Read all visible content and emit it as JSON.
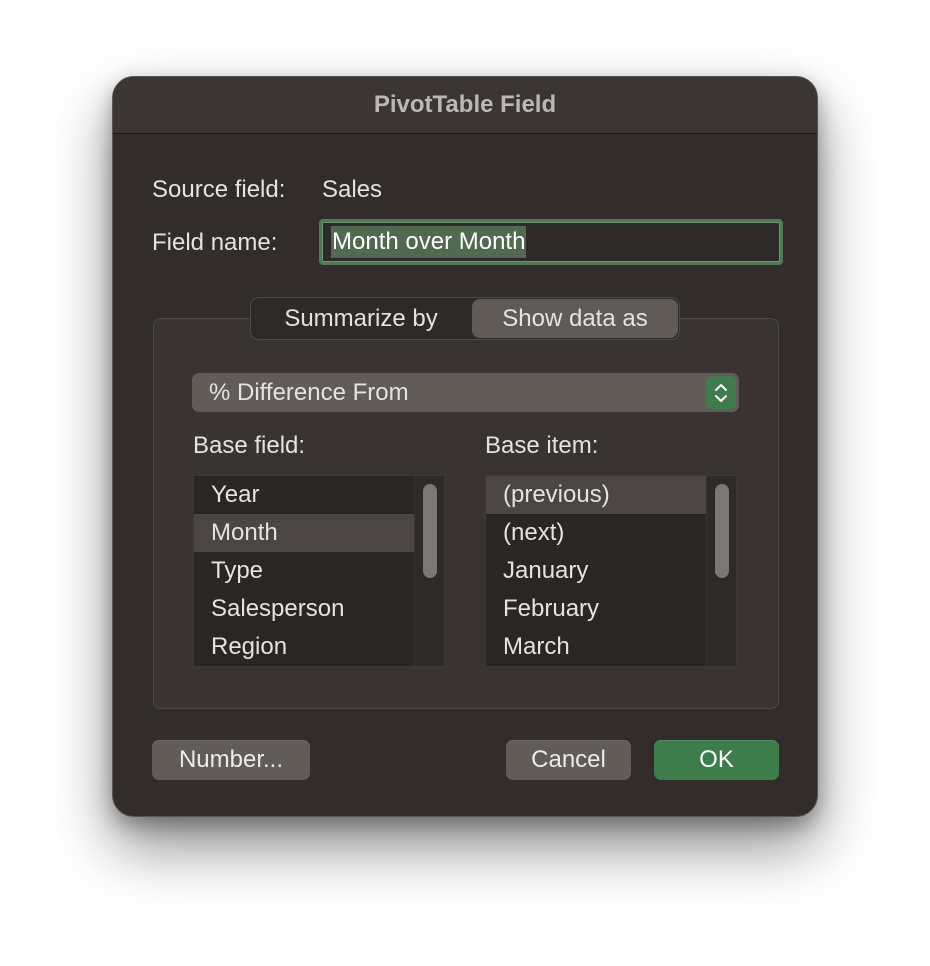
{
  "dialog": {
    "title": "PivotTable Field",
    "source_field_label": "Source field:",
    "source_field_value": "Sales",
    "field_name_label": "Field name:",
    "field_name_value": "Month over Month"
  },
  "tabs": {
    "summarize_by": "Summarize by",
    "show_data_as": "Show data as",
    "active": "show_data_as"
  },
  "show_data_as": {
    "selected": "% Difference From",
    "base_field_label": "Base field:",
    "base_item_label": "Base item:",
    "base_fields": [
      "Year",
      "Month",
      "Type",
      "Salesperson",
      "Region"
    ],
    "base_field_selected": "Month",
    "base_items": [
      "(previous)",
      "(next)",
      "January",
      "February",
      "March"
    ],
    "base_item_selected": "(previous)"
  },
  "buttons": {
    "number": "Number...",
    "cancel": "Cancel",
    "ok": "OK"
  },
  "colors": {
    "accent_green": "#3d7d4c",
    "focus_ring": "#4e7a55",
    "dialog_bg": "#322d2b"
  }
}
